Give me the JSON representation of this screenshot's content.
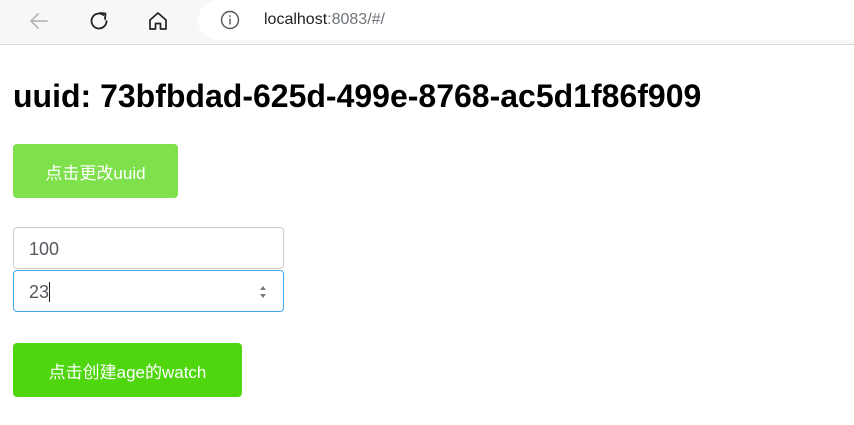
{
  "browser": {
    "url_host": "localhost",
    "url_rest": ":8083/#/"
  },
  "page": {
    "title": "uuid: 73bfbdad-625d-499e-8768-ac5d1f86f909",
    "change_uuid_button": "点击更改uuid",
    "input_first_value": "100",
    "input_second_value": "23",
    "create_watch_button": "点击创建age的watch"
  },
  "colors": {
    "primary_light": "#7ee14b",
    "primary": "#4fd60f",
    "focus_border": "#44a7e8"
  }
}
